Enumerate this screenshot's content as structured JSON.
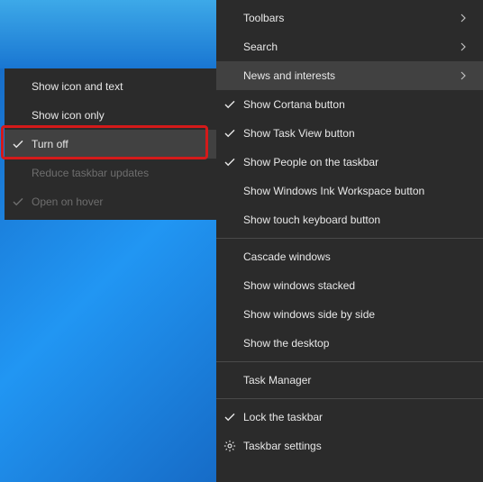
{
  "submenu": {
    "items": [
      {
        "label": "Show icon and text",
        "checked": false,
        "disabled": false
      },
      {
        "label": "Show icon only",
        "checked": false,
        "disabled": false
      },
      {
        "label": "Turn off",
        "checked": true,
        "disabled": false,
        "hover": true,
        "highlight": true
      },
      {
        "label": "Reduce taskbar updates",
        "checked": false,
        "disabled": true
      },
      {
        "label": "Open on hover",
        "checked": true,
        "disabled": true
      }
    ]
  },
  "mainmenu": {
    "groups": [
      [
        {
          "label": "Toolbars",
          "checked": false,
          "arrow": true
        },
        {
          "label": "Search",
          "checked": false,
          "arrow": true
        },
        {
          "label": "News and interests",
          "checked": false,
          "arrow": true,
          "hover": true
        },
        {
          "label": "Show Cortana button",
          "checked": true
        },
        {
          "label": "Show Task View button",
          "checked": true
        },
        {
          "label": "Show People on the taskbar",
          "checked": true
        },
        {
          "label": "Show Windows Ink Workspace button",
          "checked": false
        },
        {
          "label": "Show touch keyboard button",
          "checked": false
        }
      ],
      [
        {
          "label": "Cascade windows",
          "checked": false
        },
        {
          "label": "Show windows stacked",
          "checked": false
        },
        {
          "label": "Show windows side by side",
          "checked": false
        },
        {
          "label": "Show the desktop",
          "checked": false
        }
      ],
      [
        {
          "label": "Task Manager",
          "checked": false
        }
      ],
      [
        {
          "label": "Lock the taskbar",
          "checked": true
        },
        {
          "label": "Taskbar settings",
          "checked": false,
          "gear": true
        }
      ]
    ]
  }
}
